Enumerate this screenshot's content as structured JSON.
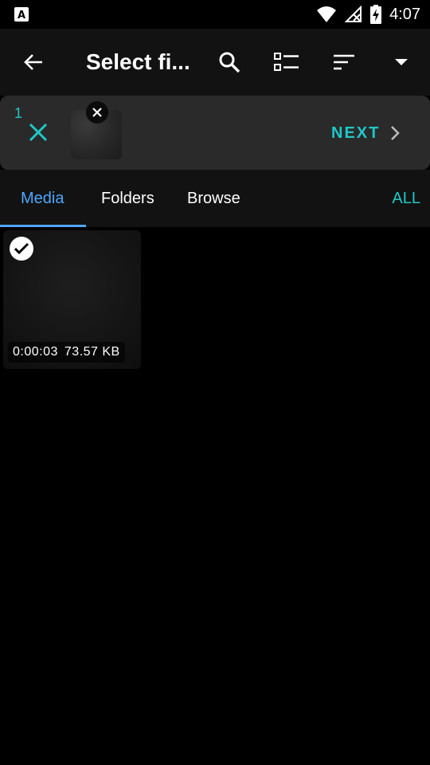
{
  "status_bar": {
    "time": "4:07",
    "icons": [
      "a-icon",
      "wifi-icon",
      "no-signal-icon",
      "battery-charging-icon"
    ]
  },
  "app_bar": {
    "title": "Select fi...",
    "icons": [
      "back-icon",
      "search-icon",
      "list-view-icon",
      "sort-icon",
      "dropdown-icon"
    ]
  },
  "selection": {
    "count": "1",
    "next_label": "NEXT"
  },
  "tabs": [
    {
      "label": "Media",
      "active": true
    },
    {
      "label": "Folders",
      "active": false
    },
    {
      "label": "Browse",
      "active": false
    }
  ],
  "tab_all_label": "ALL",
  "media_items": [
    {
      "duration": "0:00:03",
      "size": "73.57 KB",
      "selected": true
    }
  ],
  "colors": {
    "accent_teal": "#1fc8c8",
    "accent_blue": "#4da6ff",
    "appbar_bg": "#121212",
    "selection_bg": "#2a2a2a"
  }
}
